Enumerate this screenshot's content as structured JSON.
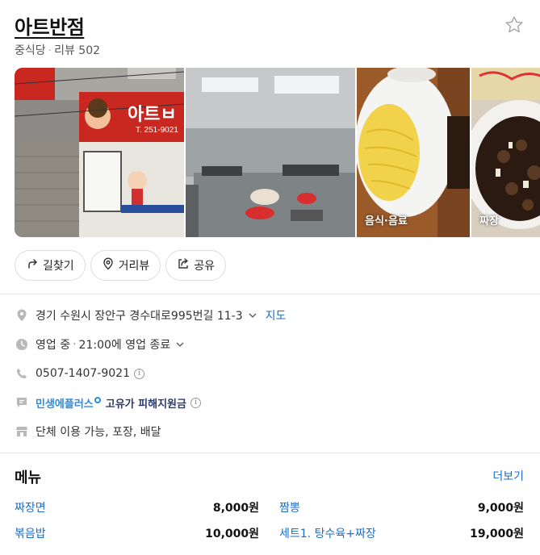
{
  "place": {
    "name": "아트반점",
    "category": "중식당",
    "separator": "·",
    "reviews": "리뷰 502"
  },
  "photos": [
    {
      "label": ""
    },
    {
      "label": ""
    },
    {
      "label": "음식·음료"
    },
    {
      "label": "짜장"
    }
  ],
  "sign_text": {
    "sign_name": "아트ㅂ",
    "sign_phone": "T. 251-9021"
  },
  "actions": {
    "directions": "길찾기",
    "street_view": "거리뷰",
    "share": "공유"
  },
  "info": {
    "address": "경기 수원시 장안구 경수대로995번길 11-3",
    "map_link": "지도",
    "status": "영업 중",
    "status_sep": "·",
    "hours": "21:00에 영업 종료",
    "phone": "0507-1407-9021",
    "promo_brand": "민생에플러스",
    "promo_text": "고유가 피해지원금",
    "services": "단체 이용 가능, 포장, 배달"
  },
  "menu": {
    "title": "메뉴",
    "more": "더보기",
    "items": [
      {
        "name": "짜장면",
        "price": "8,000원"
      },
      {
        "name": "짬뽕",
        "price": "9,000원"
      },
      {
        "name": "볶음밥",
        "price": "10,000원"
      },
      {
        "name": "세트1. 탕수육+짜장",
        "price": "19,000원"
      }
    ]
  },
  "colors": {
    "link": "#1a6ec9",
    "promo_blue": "#2b8be0",
    "sign_red": "#d81f1f"
  }
}
